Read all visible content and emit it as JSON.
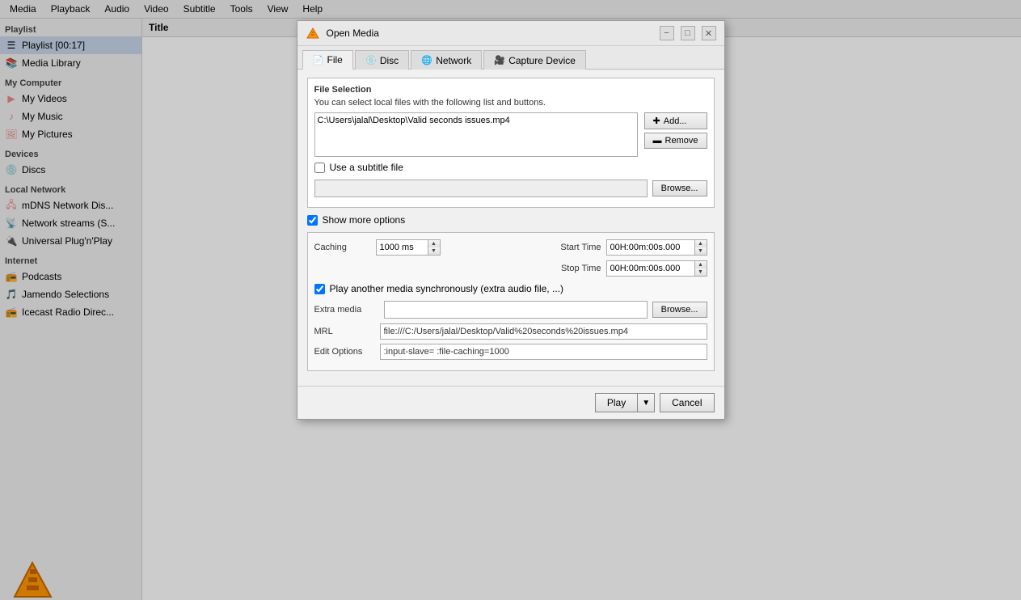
{
  "menubar": {
    "items": [
      "Media",
      "Playback",
      "Audio",
      "Video",
      "Subtitle",
      "Tools",
      "View",
      "Help"
    ]
  },
  "sidebar": {
    "playlist_section": "Playlist",
    "playlist_item": "Playlist [00:17]",
    "media_library": "Media Library",
    "my_computer_section": "My Computer",
    "my_videos": "My Videos",
    "my_music": "My Music",
    "my_pictures": "My Pictures",
    "devices_section": "Devices",
    "discs": "Discs",
    "local_network_section": "Local Network",
    "mdns": "mDNS Network Dis...",
    "network_streams": "Network streams (S...",
    "upnp": "Universal Plug'n'Play",
    "internet_section": "Internet",
    "podcasts": "Podcasts",
    "jamendo": "Jamendo Selections",
    "icecast": "Icecast Radio Direc..."
  },
  "content_header": {
    "title": "Title"
  },
  "dialog": {
    "title": "Open Media",
    "tabs": [
      {
        "id": "file",
        "label": "File",
        "active": true
      },
      {
        "id": "disc",
        "label": "Disc"
      },
      {
        "id": "network",
        "label": "Network"
      },
      {
        "id": "capture",
        "label": "Capture Device"
      }
    ],
    "file_selection_section": "File Selection",
    "file_desc": "You can select local files with the following list and buttons.",
    "file_path": "C:\\Users\\jalal\\Desktop\\Valid seconds issues.mp4",
    "add_btn": "Add...",
    "remove_btn": "Remove",
    "subtitle_checkbox_label": "Use a subtitle file",
    "subtitle_checked": false,
    "subtitle_placeholder": "",
    "subtitle_browse": "Browse...",
    "show_more_options_label": "Show more options",
    "show_more_checked": true,
    "caching_label": "Caching",
    "caching_value": "1000 ms",
    "start_time_label": "Start Time",
    "start_time_value": "00H:00m:00s.000",
    "stop_time_label": "Stop Time",
    "stop_time_value": "00H:00m:00s.000",
    "play_sync_label": "Play another media synchronously (extra audio file, ...)",
    "play_sync_checked": true,
    "extra_media_label": "Extra media",
    "extra_media_value": "",
    "extra_media_browse": "Browse...",
    "mrl_label": "MRL",
    "mrl_value": "file:///C:/Users/jalal/Desktop/Valid%20seconds%20issues.mp4",
    "edit_options_label": "Edit Options",
    "edit_options_value": ":input-slave= :file-caching=1000",
    "play_btn": "Play",
    "cancel_btn": "Cancel"
  }
}
